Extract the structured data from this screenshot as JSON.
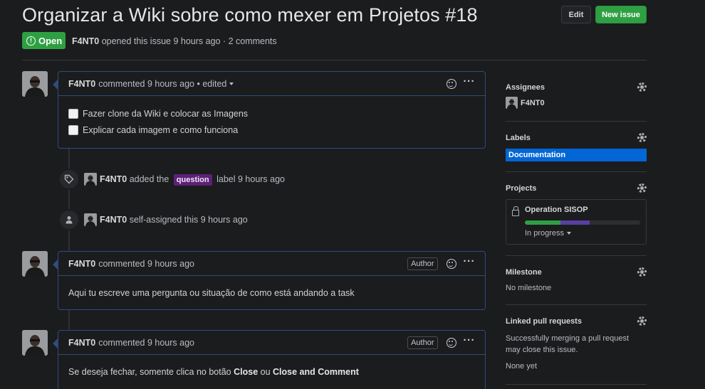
{
  "issue": {
    "title": "Organizar a Wiki sobre como mexer em Projetos #18",
    "edit_label": "Edit",
    "new_issue_label": "New issue",
    "state": "Open",
    "author": "F4NT0",
    "meta_text": "opened this issue 9 hours ago · 2 comments"
  },
  "comments": [
    {
      "author": "F4NT0",
      "meta": "commented 9 hours ago • edited",
      "author_badge": "",
      "tasks": [
        "Fazer clone da Wiki e colocar as Imagens",
        "Explicar cada imagem e como funciona"
      ]
    },
    {
      "author": "F4NT0",
      "meta": "commented 9 hours ago",
      "author_badge": "Author",
      "body": "Aqui tu escreve uma pergunta ou situação de como está andando a task"
    },
    {
      "author": "F4NT0",
      "meta": "commented 9 hours ago",
      "author_badge": "Author",
      "body_prefix": "Se deseja fechar, somente clica no botão",
      "body_bold1": "Close",
      "body_mid": "ou",
      "body_bold2": "Close and Comment"
    }
  ],
  "events": [
    {
      "icon": "tag-icon",
      "actor": "F4NT0",
      "text_before": "added the",
      "label": "question",
      "text_after": "label 9 hours ago"
    },
    {
      "icon": "person-icon",
      "actor": "F4NT0",
      "text": "self-assigned this 9 hours ago"
    }
  ],
  "sidebar": {
    "assignees": {
      "title": "Assignees",
      "user": "F4NT0"
    },
    "labels": {
      "title": "Labels",
      "label": "Documentation",
      "label_color": "#0366d6"
    },
    "projects": {
      "title": "Projects",
      "name": "Operation SISOP",
      "status": "In progress",
      "progress": [
        {
          "color": "#2ea043",
          "fraction": 0.31
        },
        {
          "color": "#5a3fa0",
          "fraction": 0.25
        }
      ]
    },
    "milestone": {
      "title": "Milestone",
      "value": "No milestone"
    },
    "linked": {
      "title": "Linked pull requests",
      "desc": "Successfully merging a pull request may close this issue.",
      "value": "None yet"
    }
  },
  "colors": {
    "open_green": "#2ea043",
    "question_purple": "#5c2176",
    "comment_border": "#2d4d7a"
  }
}
